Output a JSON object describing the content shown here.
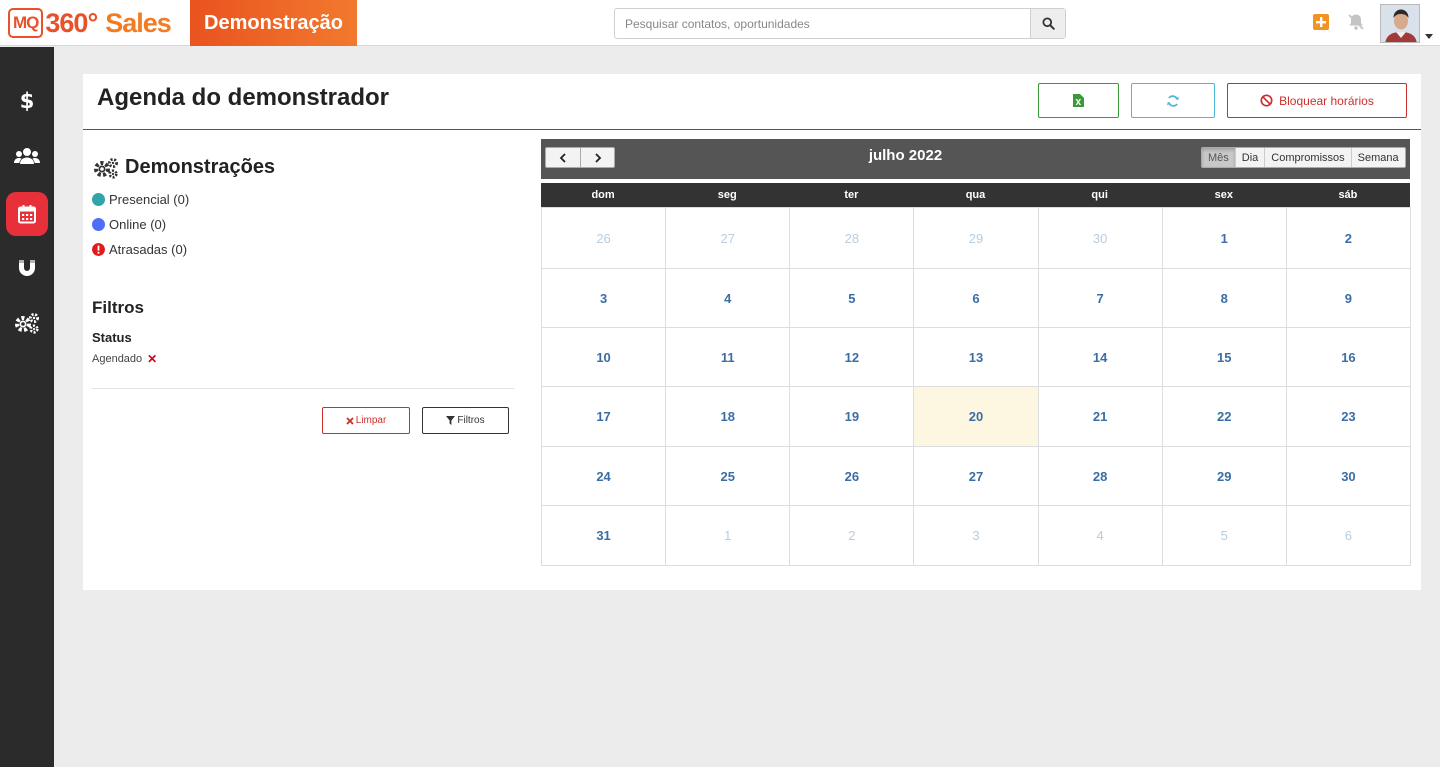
{
  "header": {
    "logo": {
      "mq": "MQ",
      "num": "360°",
      "sales": "Sales"
    },
    "context_label": "Demonstração",
    "search_placeholder": "Pesquisar contatos, oportunidades"
  },
  "page": {
    "title": "Agenda do demonstrador",
    "buttons": {
      "block_label": "Bloquear horários"
    }
  },
  "legend": {
    "title": "Demonstrações",
    "items": [
      {
        "label": "Presencial (0)",
        "color": "#2fa4a9"
      },
      {
        "label": "Online (0)",
        "color": "#4f6ef7"
      },
      {
        "label": "Atrasadas (0)",
        "color": "#e41a1a"
      }
    ]
  },
  "filters": {
    "title": "Filtros",
    "status_label": "Status",
    "status_value": "Agendado",
    "clear_label": "Limpar",
    "filters_label": "Filtros"
  },
  "calendar": {
    "title": "julho 2022",
    "views": [
      "Mês",
      "Dia",
      "Compromissos",
      "Semana"
    ],
    "active_view": "Mês",
    "weekdays": [
      "dom",
      "seg",
      "ter",
      "qua",
      "qui",
      "sex",
      "sáb"
    ],
    "today": 20,
    "weeks": [
      [
        "26",
        "27",
        "28",
        "29",
        "30",
        "1",
        "2"
      ],
      [
        "3",
        "4",
        "5",
        "6",
        "7",
        "8",
        "9"
      ],
      [
        "10",
        "11",
        "12",
        "13",
        "14",
        "15",
        "16"
      ],
      [
        "17",
        "18",
        "19",
        "20",
        "21",
        "22",
        "23"
      ],
      [
        "24",
        "25",
        "26",
        "27",
        "28",
        "29",
        "30"
      ],
      [
        "31",
        "1",
        "2",
        "3",
        "4",
        "5",
        "6"
      ]
    ]
  },
  "colors": {
    "brand_orange": "#e8512a",
    "sidebar_bg": "#2b2b2b",
    "sidebar_active": "#e8303a",
    "today_bg": "#fdf7e1"
  }
}
